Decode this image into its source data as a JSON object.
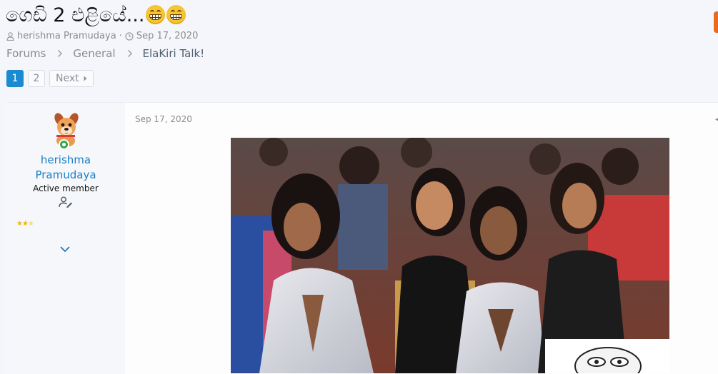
{
  "thread": {
    "title": "ගෙඩි 2 එළියේ...",
    "emoji_icons": [
      "grinning-face-icon",
      "grinning-face-icon"
    ],
    "author": "herishma Pramudaya",
    "meta_separator": "·",
    "date": "Sep 17, 2020"
  },
  "breadcrumb": {
    "items": [
      "Forums",
      "General",
      "ElaKiri Talk!"
    ]
  },
  "pagination": {
    "pages": [
      "1",
      "2"
    ],
    "current": "1",
    "next_label": "Next"
  },
  "post": {
    "username_first": "herishma",
    "username_last": "Pramudaya",
    "user_title": "Active member",
    "rating_stars": 2.5,
    "date": "Sep 17, 2020"
  },
  "colors": {
    "accent": "#1a8ad1",
    "username": "#1a7fc4",
    "background": "#f5f6fb"
  }
}
